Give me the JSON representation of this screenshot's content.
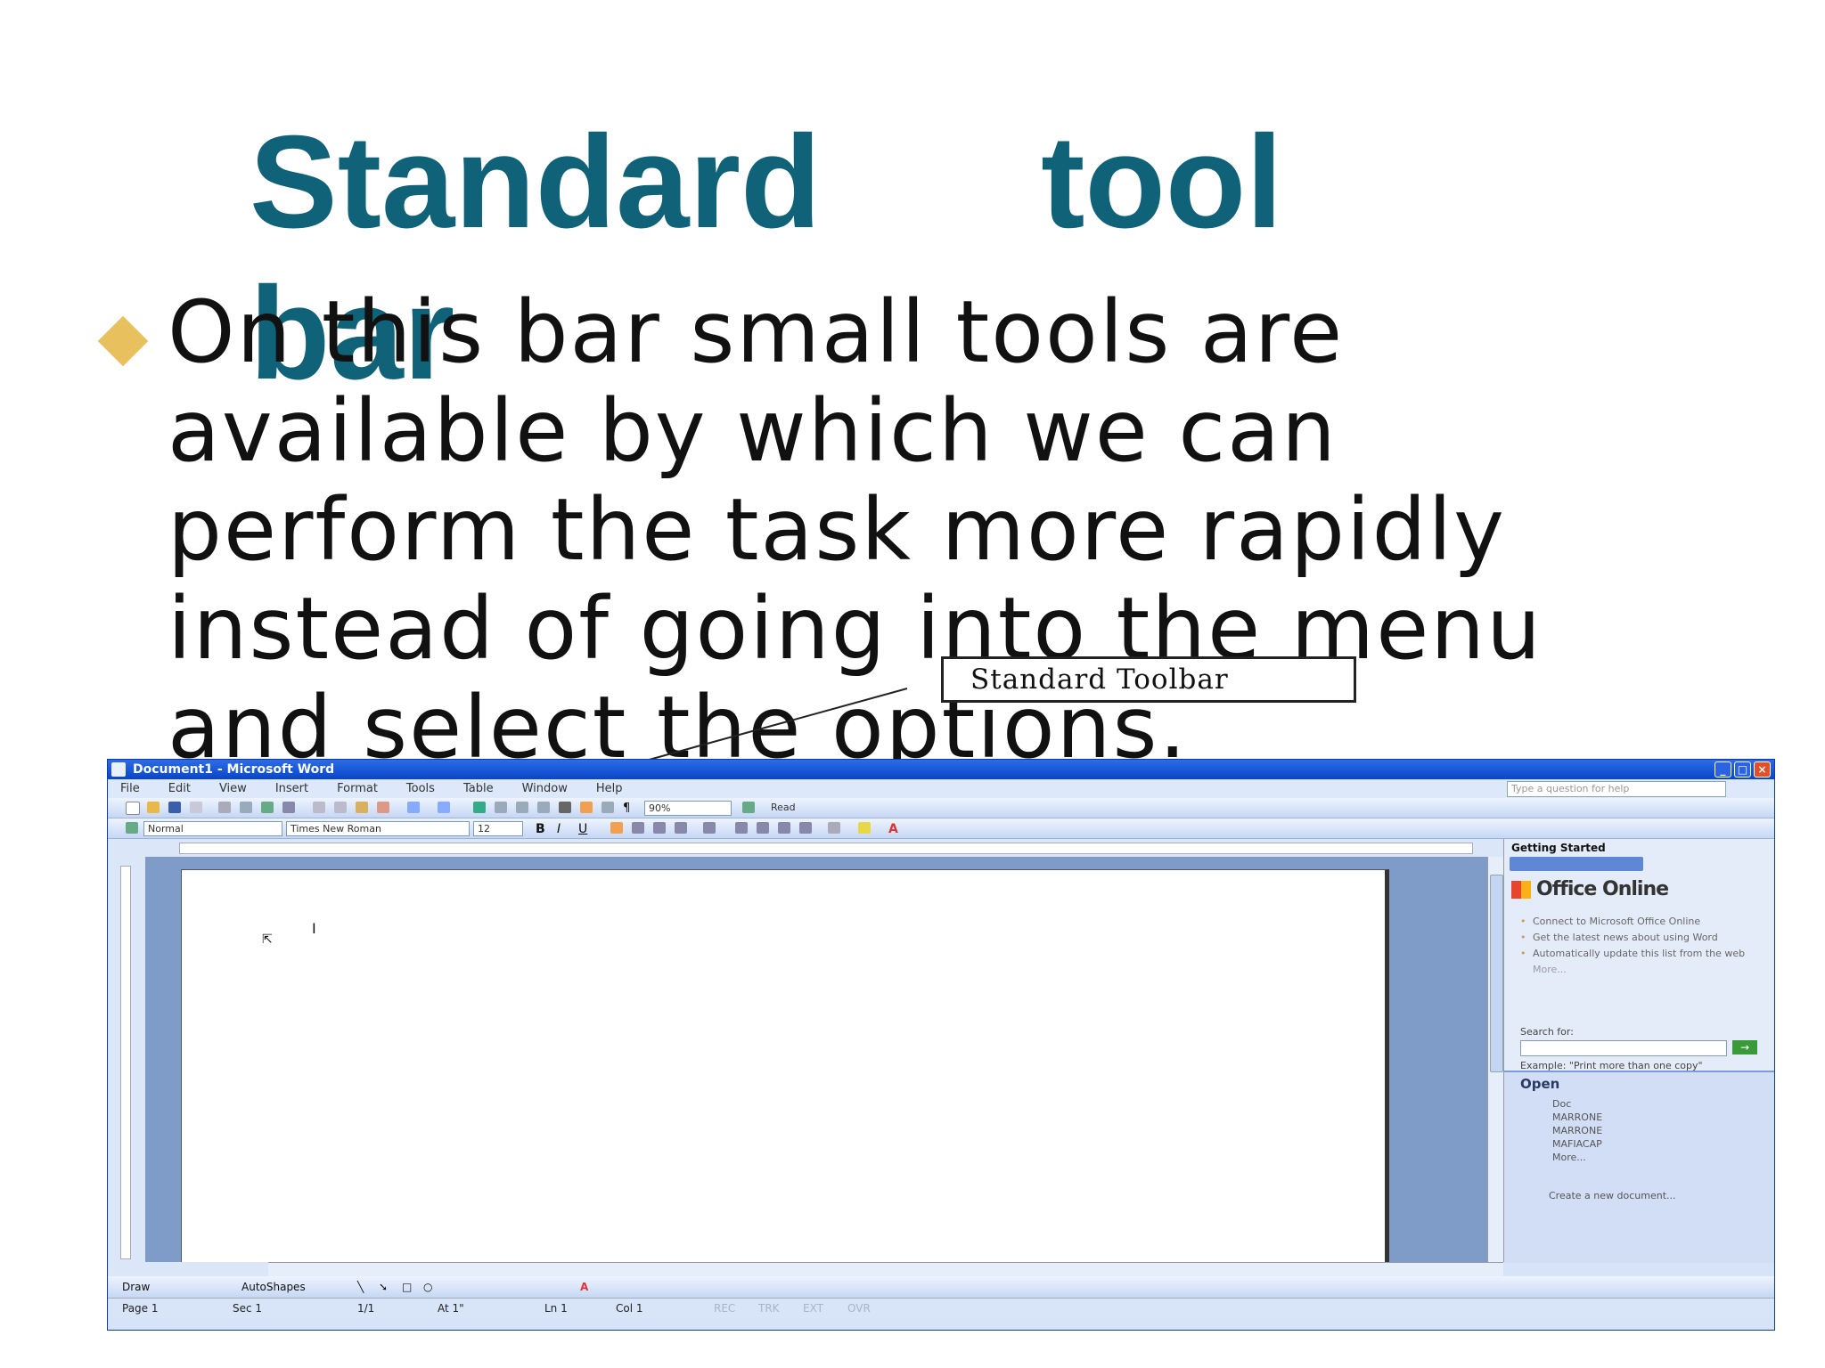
{
  "slide": {
    "title": "Standard      tool bar",
    "body": "On this bar small tools are available by which we can perform the task more rapidly instead of going into the menu and select the options.",
    "callout": "Standard Toolbar",
    "accent_color": "#0f6277",
    "bullet_color": "#e8c15e"
  },
  "word": {
    "window_title": "Document1 - Microsoft Word",
    "window_buttons": [
      "minimize-icon",
      "restore-icon",
      "close-icon"
    ],
    "menu": [
      "File",
      "Edit",
      "View",
      "Insert",
      "Format",
      "Tools",
      "Table",
      "Window",
      "Help"
    ],
    "help_placeholder": "Type a question for help",
    "zoom": "90%",
    "read_label": "Read",
    "style": "Normal",
    "font": "Times New Roman",
    "font_size": "12",
    "format_buttons": [
      "B",
      "I",
      "U"
    ],
    "task_pane": {
      "title": "Getting Started",
      "office_online": "Office Online",
      "links": [
        "Connect to Microsoft Office Online",
        "Get the latest news about using Word",
        "Automatically update this list from the web"
      ],
      "more": "More...",
      "search_label": "Search for:",
      "example": "Example: \"Print more than one copy\"",
      "open_heading": "Open",
      "open_files": [
        "Doc",
        "MARRONE",
        "MARRONE",
        "MAFIACAP",
        "More..."
      ],
      "create": "Create a new document..."
    },
    "draw_label": "Draw",
    "autoshapes_label": "AutoShapes",
    "status": {
      "page": "Page  1",
      "sec": "Sec  1",
      "pages": "1/1",
      "at": "At  1\"",
      "ln": "Ln  1",
      "col": "Col  1",
      "modes": [
        "REC",
        "TRK",
        "EXT",
        "OVR"
      ]
    }
  }
}
